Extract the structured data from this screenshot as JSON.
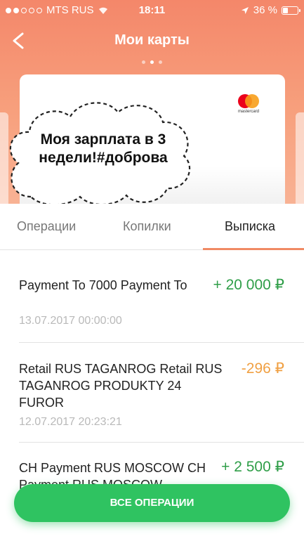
{
  "status_bar": {
    "carrier": "MTS RUS",
    "time": "18:11",
    "battery": "36 %"
  },
  "nav": {
    "title": "Мои карты"
  },
  "bubble": {
    "text": "Моя зарплата в 3 недели!#доброва"
  },
  "card": {
    "brand_text": "mastercard"
  },
  "tabs": [
    {
      "label": "Операции"
    },
    {
      "label": "Копилки"
    },
    {
      "label": "Выписка"
    }
  ],
  "transactions": [
    {
      "title": "Payment To 7000 Payment To",
      "amount": "+ 20 000 ₽",
      "date": "13.07.2017  00:00:00"
    },
    {
      "title": "Retail RUS TAGANROG Retail RUS TAGANROG PRODUKTY 24 FUROR",
      "amount": "-296 ₽",
      "date": "12.07.2017  20:23:21"
    },
    {
      "title": "CH Payment RUS MOSCOW CH Payment RUS MOSCOW",
      "amount": "+ 2 500 ₽",
      "date": ""
    }
  ],
  "all_operations_button": "ВСЕ ОПЕРАЦИИ",
  "colors": {
    "header_gradient_top": "#f4876a",
    "accent_orange": "#f08a64",
    "income_green": "#2f9e48",
    "expense_orange": "#f0a043",
    "button_green": "#2fc361"
  }
}
